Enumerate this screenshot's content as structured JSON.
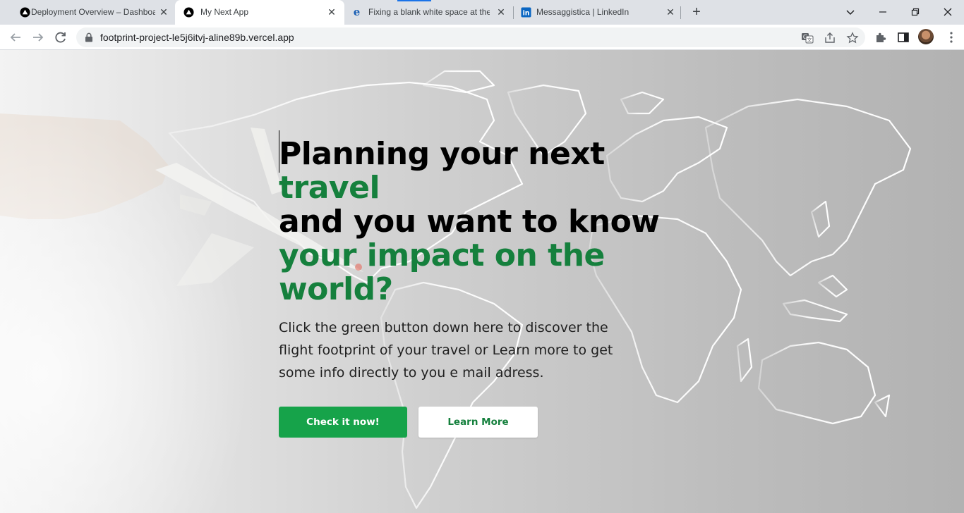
{
  "browser": {
    "tabs": [
      {
        "title": "Deployment Overview – Dashboard",
        "favicon": "vercel-triangle-icon",
        "active": false
      },
      {
        "title": "My Next App",
        "favicon": "vercel-triangle-icon",
        "active": true
      },
      {
        "title": "Fixing a blank white space at the",
        "favicon": "edge-e-icon",
        "active": false
      },
      {
        "title": "Messaggistica | LinkedIn",
        "favicon": "linkedin-icon",
        "active": false
      }
    ],
    "new_tab_label": "+",
    "url": "footprint-project-le5j6itvj-aline89b.vercel.app",
    "accent_color": "#1a73e8"
  },
  "hero": {
    "headline_line1": "Planning your next",
    "headline_line2": "travel",
    "headline_line3": "and you want to know",
    "headline_line4": "your impact on the",
    "headline_line5": "world?",
    "description": "Click the green button down here to discover the flight footprint of your travel or Learn more to get some info directly to you e mail adress.",
    "primary_button": "Check it now!",
    "secondary_button": "Learn More",
    "colors": {
      "headline": "#000000",
      "highlight": "#15803d",
      "primary_button_bg": "#16a34a"
    }
  }
}
